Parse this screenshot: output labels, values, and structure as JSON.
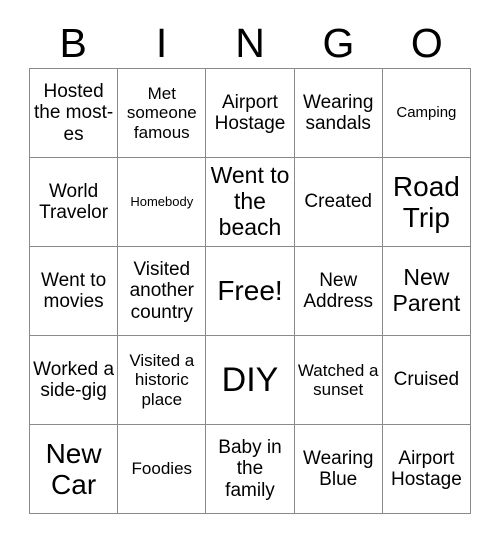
{
  "header": {
    "letters": [
      "B",
      "I",
      "N",
      "G",
      "O"
    ]
  },
  "grid": {
    "rows": [
      [
        {
          "text": "Hosted the most-es",
          "size": "lg"
        },
        {
          "text": "Met someone famous",
          "size": "md"
        },
        {
          "text": "Airport Hostage",
          "size": "lg"
        },
        {
          "text": "Wearing sandals",
          "size": "lg"
        },
        {
          "text": "Camping",
          "size": "sm"
        }
      ],
      [
        {
          "text": "World Travelor",
          "size": "lg"
        },
        {
          "text": "Homebody",
          "size": "xs"
        },
        {
          "text": "Went to the beach",
          "size": "xl"
        },
        {
          "text": "Created",
          "size": "lg"
        },
        {
          "text": "Road Trip",
          "size": "xxl"
        }
      ],
      [
        {
          "text": "Went to movies",
          "size": "lg"
        },
        {
          "text": "Visited another country",
          "size": "lg"
        },
        {
          "text": "Free!",
          "size": "xxl"
        },
        {
          "text": "New Address",
          "size": "lg"
        },
        {
          "text": "New Parent",
          "size": "xl"
        }
      ],
      [
        {
          "text": "Worked a side-gig",
          "size": "lg"
        },
        {
          "text": "Visited a historic place",
          "size": "md"
        },
        {
          "text": "DIY",
          "size": "huge"
        },
        {
          "text": "Watched a sunset",
          "size": "md"
        },
        {
          "text": "Cruised",
          "size": "lg"
        }
      ],
      [
        {
          "text": "New Car",
          "size": "xxl"
        },
        {
          "text": "Foodies",
          "size": "md"
        },
        {
          "text": "Baby in the family",
          "size": "lg"
        },
        {
          "text": "Wearing Blue",
          "size": "lg"
        },
        {
          "text": "Airport Hostage",
          "size": "lg"
        }
      ]
    ]
  },
  "colors": {
    "border": "#8a8a8a",
    "text": "#000000",
    "background": "#ffffff"
  }
}
